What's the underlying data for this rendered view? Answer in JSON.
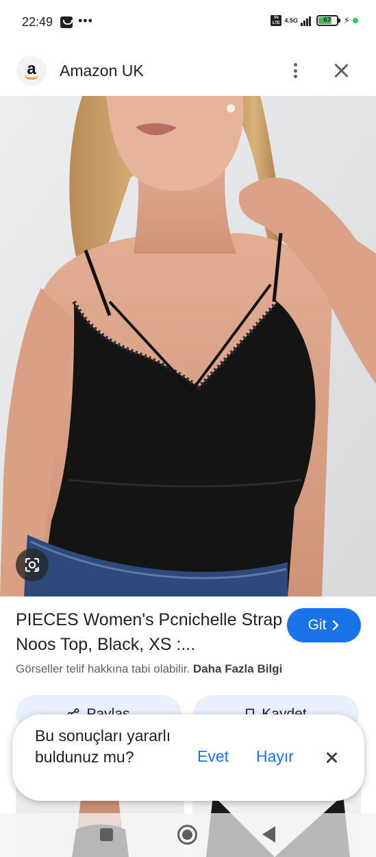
{
  "status_bar": {
    "time": "22:49",
    "overflow": "•••",
    "volte": "Vo LTE",
    "network": "4.5G",
    "battery": "67"
  },
  "header": {
    "site_name": "Amazon UK",
    "logo_letter": "a"
  },
  "product": {
    "title": "PIECES Women's Pcnichelle Strap Noos Top, Black, XS :...",
    "go_label": "Git",
    "copyright_text": "Görseller telif hakkına tabi olabilir.",
    "more_info_label": "Daha Fazla Bilgi"
  },
  "actions": {
    "share_label": "Paylaş",
    "save_label": "Kaydet"
  },
  "feedback": {
    "question": "Bu sonuçları yararlı buldunuz mu?",
    "yes_label": "Evet",
    "no_label": "Hayır"
  },
  "colors": {
    "accent": "#1a73e8",
    "chip_background": "#e8f0fe",
    "battery_green": "#3fc04f"
  },
  "icons": [
    "notification-icon",
    "signal-icon",
    "battery-icon",
    "more-vert-icon",
    "close-icon",
    "google-lens-icon",
    "chevron-right-icon",
    "share-icon",
    "bookmark-icon",
    "recent-apps-icon",
    "home-icon",
    "back-icon"
  ]
}
